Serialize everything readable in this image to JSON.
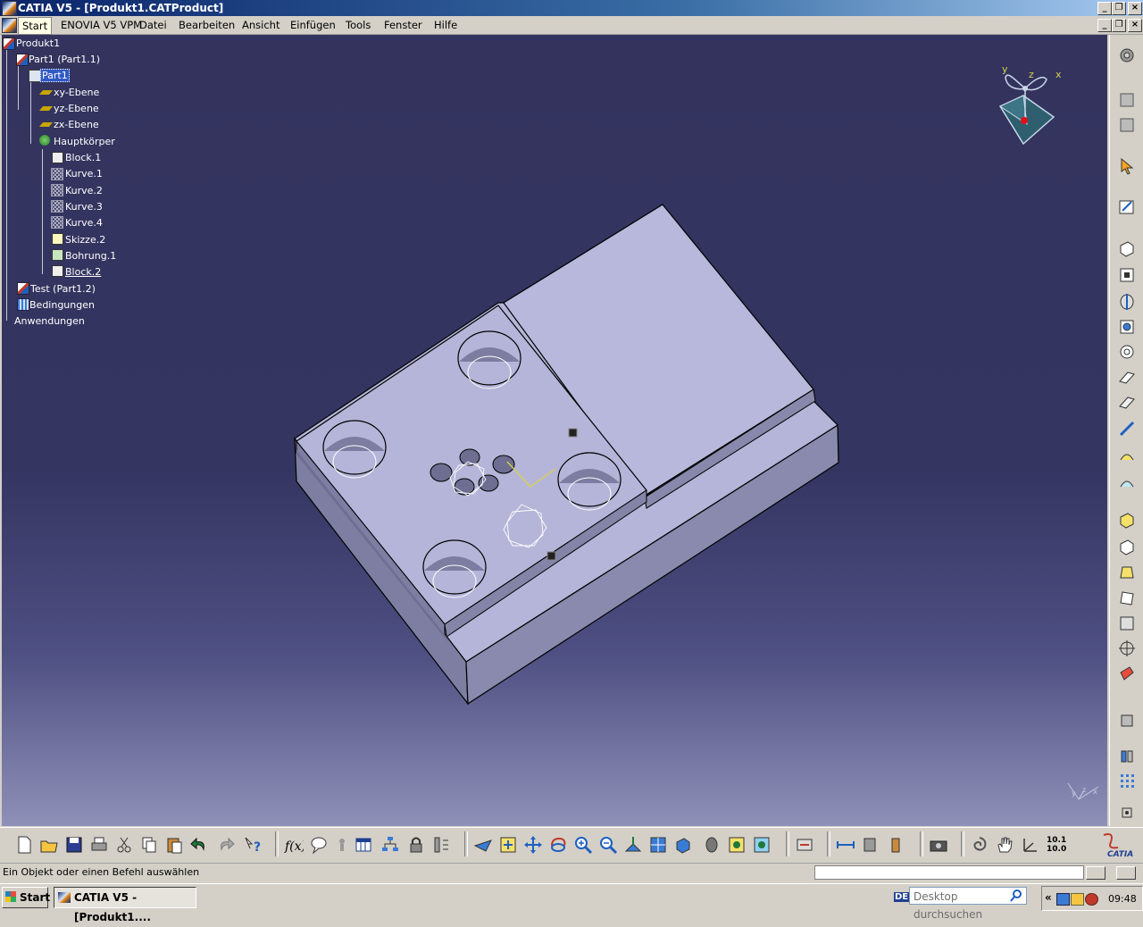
{
  "window": {
    "title": "CATIA V5 - [Produkt1.CATProduct]",
    "controls": {
      "minimize": "_",
      "restore": "❐",
      "close": "×"
    }
  },
  "menubar": {
    "items": [
      "Start",
      "ENOVIA V5 VPM",
      "Datei",
      "Bearbeiten",
      "Ansicht",
      "Einfügen",
      "Tools",
      "Fenster",
      "Hilfe"
    ]
  },
  "tree": {
    "root": "Produkt1",
    "part1_instance": "Part1 (Part1.1)",
    "part1": "Part1",
    "planes": [
      "xy-Ebene",
      "yz-Ebene",
      "zx-Ebene"
    ],
    "body": "Hauptkörper",
    "features": [
      "Block.1",
      "Kurve.1",
      "Kurve.2",
      "Kurve.3",
      "Kurve.4",
      "Skizze.2",
      "Bohrung.1",
      "Block.2"
    ],
    "test_instance": "Test (Part1.2)",
    "constraints": "Bedingungen",
    "applications": "Anwendungen"
  },
  "compass": {
    "x": "x",
    "y": "y",
    "z": "z"
  },
  "status": {
    "prompt": "Ein Objekt oder einen Befehl auswählen",
    "command_value": ""
  },
  "bottom_toolbar": {
    "scale_label_top": "10.1",
    "scale_label_bottom": "10.0",
    "brand": "CATIA"
  },
  "taskbar": {
    "start": "Start",
    "task": "CATIA V5 - [Produkt1....",
    "lang": "DE",
    "search_placeholder": "Desktop durchsuchen",
    "tray_arrow": "«",
    "clock": "09:48"
  },
  "colors": {
    "viewport_top": "#33335e",
    "viewport_bottom": "#8f90b8",
    "part_top": "#b5b5d9",
    "part_side": "#7e7ea2",
    "selection": "#3159c6"
  }
}
